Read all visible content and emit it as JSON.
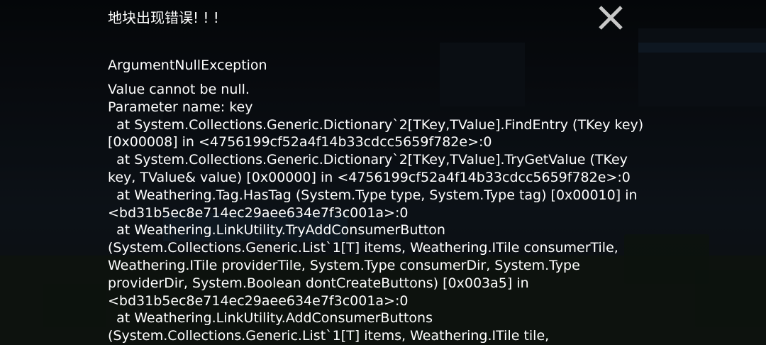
{
  "dialog": {
    "title": "地块出现错误! ! !",
    "close_icon": "close-icon",
    "exception_type": "ArgumentNullException",
    "message_lines": [
      "Value cannot be null.",
      "Parameter name: key",
      "  at System.Collections.Generic.Dictionary`2[TKey,TValue].FindEntry (TKey key)",
      "[0x00008] in <4756199cf52a4f14b33cdcc5659f782e>:0",
      "  at System.Collections.Generic.Dictionary`2[TKey,TValue].TryGetValue (TKey",
      "key, TValue& value) [0x00000] in <4756199cf52a4f14b33cdcc5659f782e>:0",
      "  at Weathering.Tag.HasTag (System.Type type, System.Type tag) [0x00010] in",
      "<bd31b5ec8e714ec29aee634e7f3c001a>:0",
      "  at Weathering.LinkUtility.TryAddConsumerButton",
      "(System.Collections.Generic.List`1[T] items, Weathering.ITile consumerTile,",
      "Weathering.ITile providerTile, System.Type consumerDir, System.Type",
      "providerDir, System.Boolean dontCreateButtons) [0x003a5] in",
      "<bd31b5ec8e714ec29aee634e7f3c001a>:0",
      "  at Weathering.LinkUtility.AddConsumerButtons",
      "(System.Collections.Generic.List`1[T] items, Weathering.ITile tile,"
    ]
  },
  "colors": {
    "text": "#ffffff",
    "close_icon": "#c8c8c8"
  }
}
